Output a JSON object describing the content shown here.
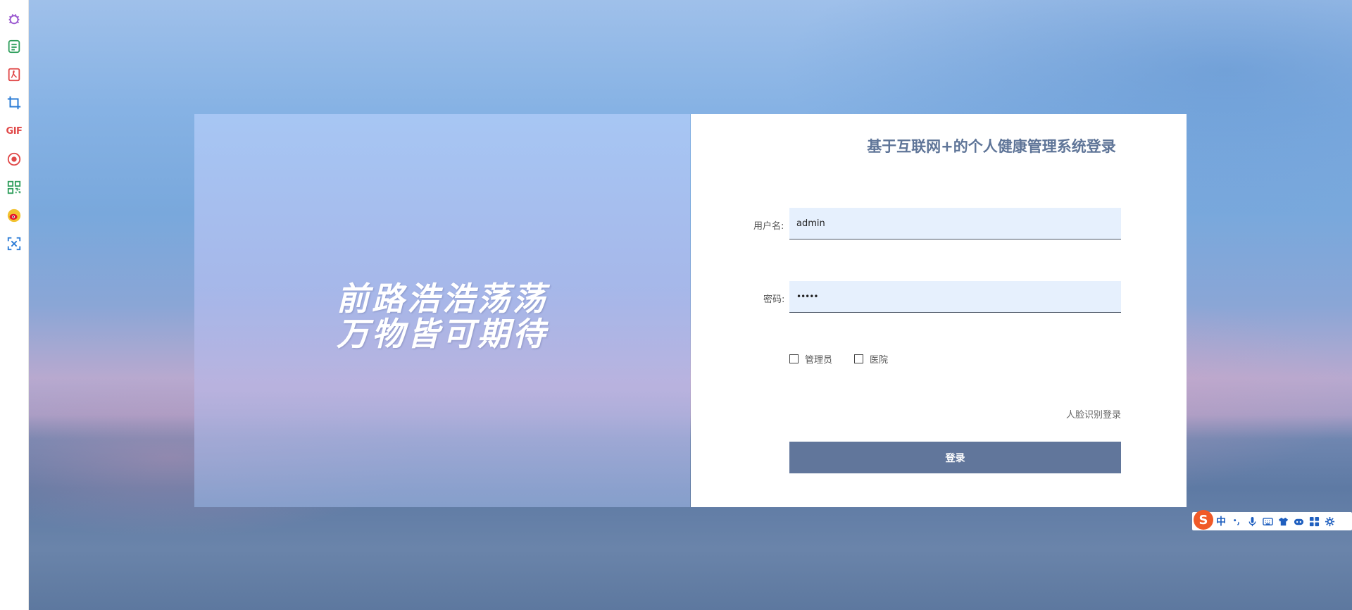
{
  "sidebar_tools": [
    {
      "name": "bug-icon",
      "color": "#9b59d0"
    },
    {
      "name": "notes-icon",
      "color": "#2e9e5b"
    },
    {
      "name": "pdf-icon",
      "color": "#e04848"
    },
    {
      "name": "crop-icon",
      "color": "#2a7bd6"
    },
    {
      "name": "gif-icon",
      "color": "#e04848",
      "label": "GIF"
    },
    {
      "name": "record-icon",
      "color": "#e04848"
    },
    {
      "name": "qrcode-icon",
      "color": "#2e9e5b"
    },
    {
      "name": "weibo-icon",
      "color": "#e6162d"
    },
    {
      "name": "scan-icon",
      "color": "#2a7bd6"
    }
  ],
  "banner": {
    "slogan_line1": "前路浩浩荡荡",
    "slogan_line2": "万物皆可期待"
  },
  "login": {
    "title": "基于互联网+的个人健康管理系统登录",
    "username_label": "用户名:",
    "username_value": "admin",
    "password_label": "密码:",
    "password_value": "•••••",
    "role_admin": "管理员",
    "role_hospital": "医院",
    "face_login": "人脸识别登录",
    "submit": "登录"
  },
  "ime": {
    "logo": "S",
    "mode": "中",
    "items": [
      "punctuation-icon",
      "microphone-icon",
      "keyboard-icon",
      "skin-icon",
      "emoji-icon",
      "apps-icon",
      "settings-icon"
    ]
  },
  "colors": {
    "button": "#61769b",
    "title": "#5f7598",
    "input_bg": "#e6f0fd"
  }
}
